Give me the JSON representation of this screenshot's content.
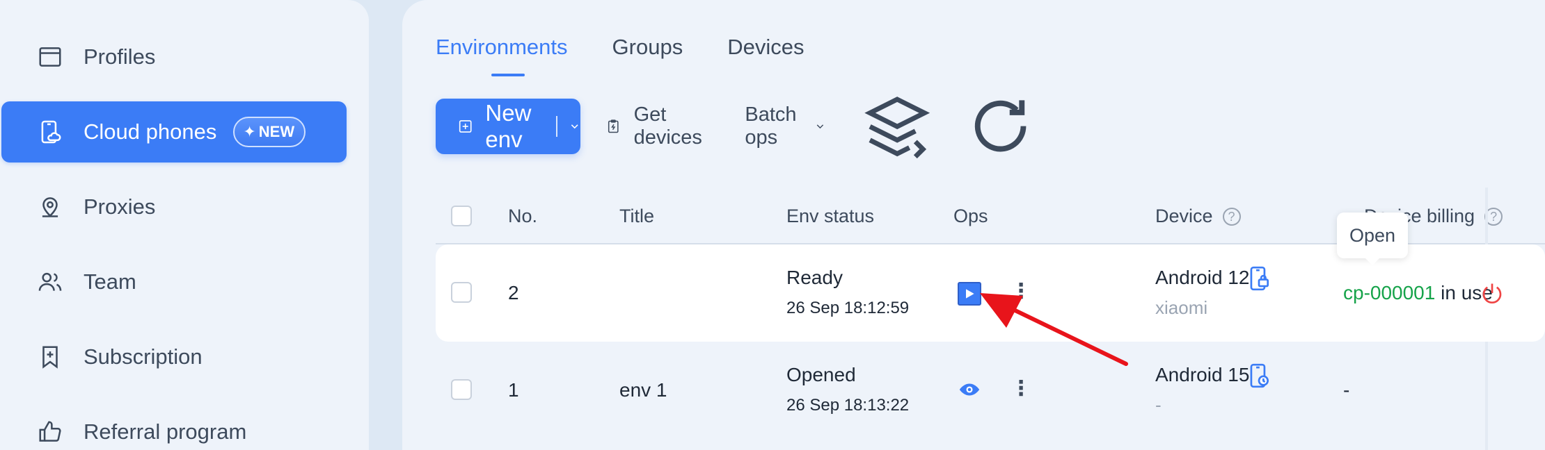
{
  "sidebar": {
    "items": [
      {
        "label": "Profiles",
        "icon": "browser-window-icon"
      },
      {
        "label": "Cloud phones",
        "icon": "cloud-phone-icon",
        "badge": "NEW",
        "active": true
      },
      {
        "label": "Proxies",
        "icon": "location-pin-icon"
      },
      {
        "label": "Team",
        "icon": "users-icon"
      },
      {
        "label": "Subscription",
        "icon": "bookmark-plus-icon"
      },
      {
        "label": "Referral program",
        "icon": "thumbs-up-icon"
      }
    ]
  },
  "tabs": [
    {
      "label": "Environments",
      "active": true
    },
    {
      "label": "Groups"
    },
    {
      "label": "Devices"
    }
  ],
  "toolbar": {
    "new_env": "New env",
    "get_devices": "Get devices",
    "batch_ops": "Batch ops"
  },
  "table": {
    "columns": {
      "no": "No.",
      "title": "Title",
      "env_status": "Env status",
      "ops": "Ops",
      "device": "Device",
      "device_billing": "Device billing"
    },
    "rows": [
      {
        "no": "2",
        "title": "",
        "status": "Ready",
        "status_time": "26 Sep 18:12:59",
        "device": "Android 12",
        "device_sub": "xiaomi",
        "billing_id": "cp-000001",
        "billing_text": "in use"
      },
      {
        "no": "1",
        "title": "env 1",
        "status": "Opened",
        "status_time": "26 Sep 18:13:22",
        "device": "Android 15",
        "device_sub": "-",
        "billing_text": "-"
      }
    ]
  },
  "tooltip": "Open",
  "colors": {
    "accent": "#3b7cf6",
    "billing_green": "#16a34a",
    "power_red": "#ef4444",
    "arrow_red": "#e8141b"
  }
}
